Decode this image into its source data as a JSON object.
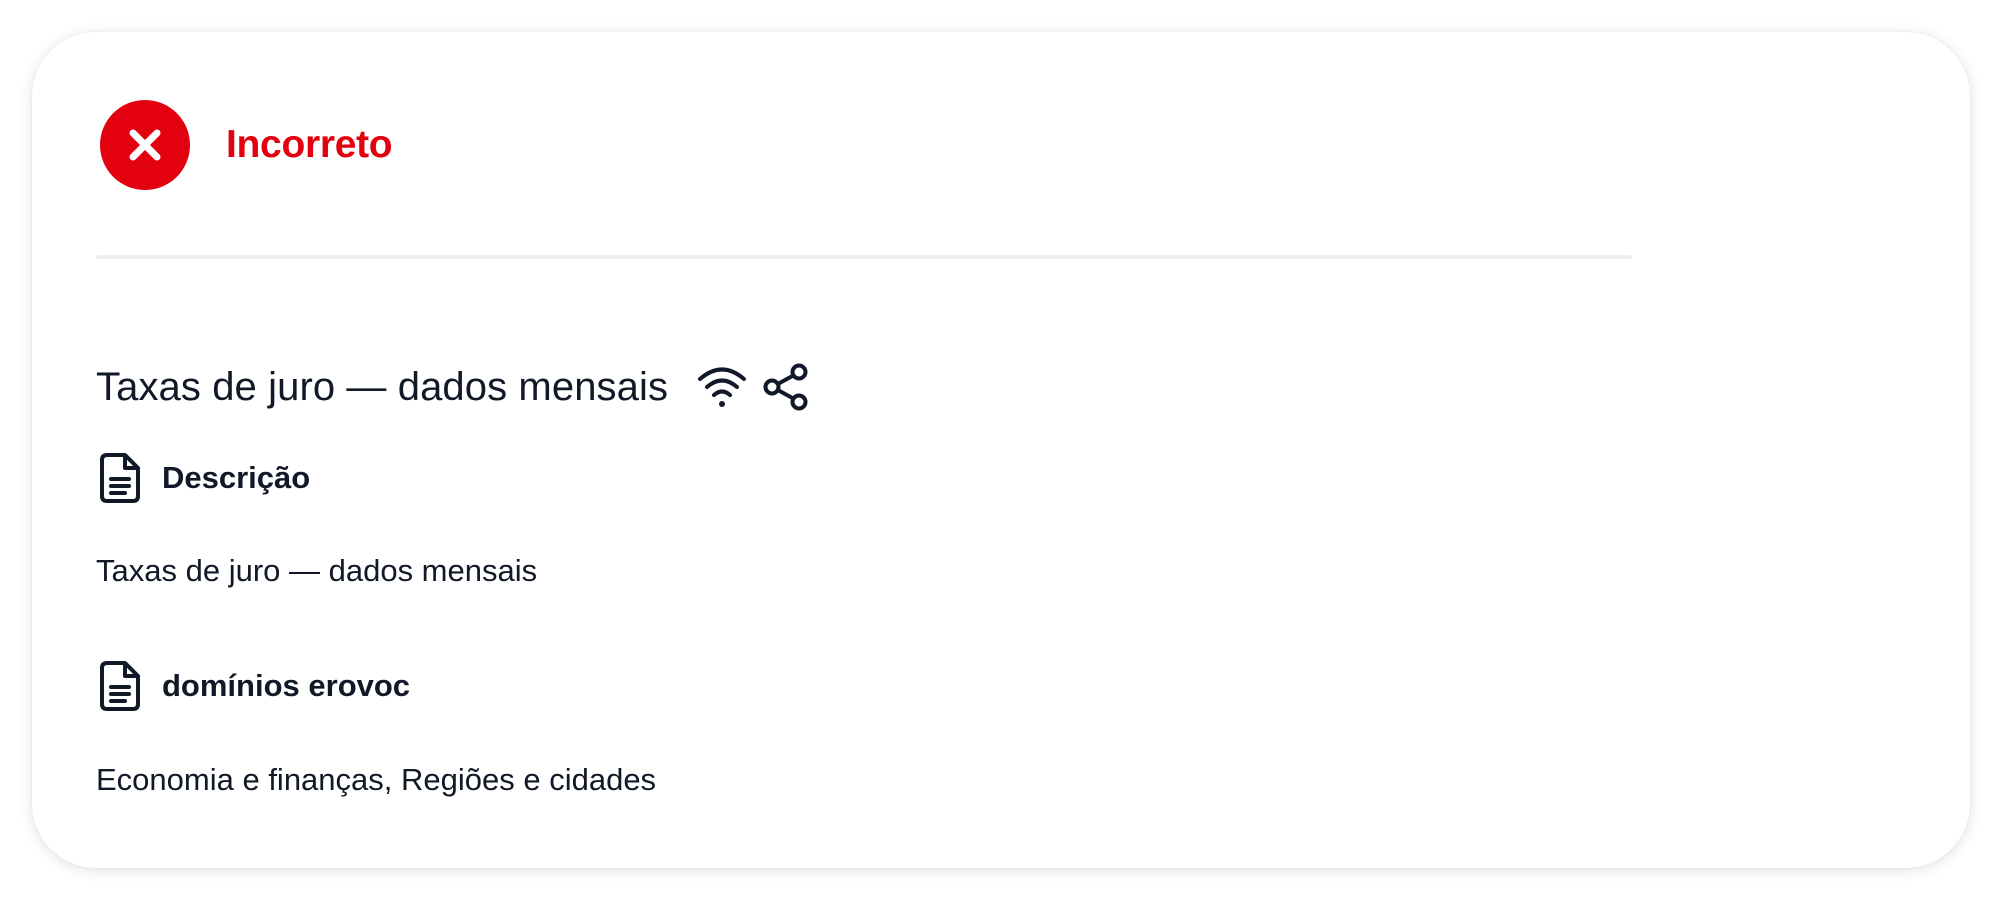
{
  "status": {
    "label": "Incorreto",
    "icon": "x-circle-icon",
    "color": "#e3000f"
  },
  "dataset": {
    "title": "Taxas de juro — dados mensais",
    "actions": [
      {
        "icon": "rss-icon"
      },
      {
        "icon": "share-icon"
      }
    ]
  },
  "sections": [
    {
      "icon": "document-icon",
      "heading": "Descrição",
      "body": "Taxas de juro — dados mensais"
    },
    {
      "icon": "document-icon",
      "heading": "domínios erovoc",
      "body": "Economia e finanças, Regiões e cidades"
    }
  ],
  "colors": {
    "text": "#111827",
    "error": "#e3000f",
    "divider": "#eceef3"
  }
}
